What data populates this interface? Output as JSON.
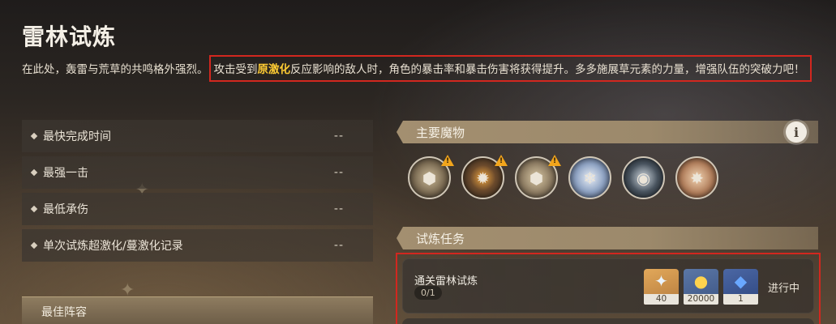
{
  "header": {
    "title": "雷林试炼",
    "desc_prefix": "在此处，轰雷与荒草的共鸣格外强烈。",
    "desc_part1": "攻击受到",
    "desc_highlight": "原激化",
    "desc_part2": "反应影响的敌人时，角色的暴击率和暴击伤害将获得提升。多多施展草元素的力量，增强队伍的突破力吧！"
  },
  "stats": [
    {
      "label": "最快完成时间",
      "value": "--"
    },
    {
      "label": "最强一击",
      "value": "--"
    },
    {
      "label": "最低承伤",
      "value": "--"
    },
    {
      "label": "单次试炼超激化/蔓激化记录",
      "value": "--"
    }
  ],
  "team": {
    "label": "最佳阵容"
  },
  "monsters_section": {
    "title": "主要魔物",
    "info_icon": "info-icon"
  },
  "monsters": [
    {
      "icon": "monster-icon",
      "warning": true
    },
    {
      "icon": "monster-icon",
      "warning": true
    },
    {
      "icon": "monster-icon",
      "warning": true
    },
    {
      "icon": "monster-icon",
      "warning": false
    },
    {
      "icon": "monster-icon",
      "warning": false
    },
    {
      "icon": "monster-icon",
      "warning": false
    }
  ],
  "tasks_section": {
    "title": "试炼任务"
  },
  "task": {
    "name": "通关雷林试炼",
    "progress": "0/1",
    "status": "进行中",
    "rewards": [
      {
        "icon": "primogem-icon",
        "count": "40"
      },
      {
        "icon": "mora-icon",
        "count": "20000"
      },
      {
        "icon": "hero-wit-icon",
        "count": "1"
      }
    ]
  },
  "colors": {
    "accent_gold": "#ffcc33",
    "highlight_border": "#d2271f",
    "header_bar": "#a38f70"
  }
}
